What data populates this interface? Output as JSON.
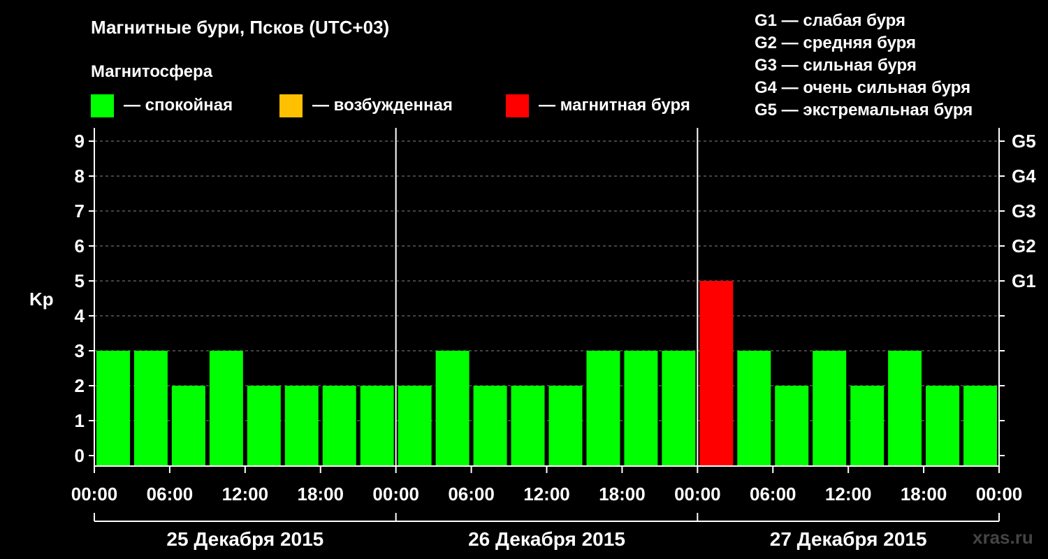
{
  "chart_data": {
    "type": "bar",
    "title": "Магнитные бури, Псков (UTC+03)",
    "subtitle": "Магнитосфера",
    "legend": [
      {
        "label": "— спокойная",
        "color": "#00ff00"
      },
      {
        "label": "— возбужденная",
        "color": "#ffc000"
      },
      {
        "label": "— магнитная буря",
        "color": "#ff0000"
      }
    ],
    "storm_scale_legend": [
      "G1 — слабая буря",
      "G2 — средняя буря",
      "G3 — сильная буря",
      "G4 — очень сильная буря",
      "G5 — экстремальная буря"
    ],
    "ylabel": "Kp",
    "ylim": [
      0,
      9
    ],
    "y_ticks": [
      "0",
      "1",
      "2",
      "3",
      "4",
      "5",
      "6",
      "7",
      "8",
      "9"
    ],
    "right_ticks": [
      {
        "value": 5,
        "label": "G1"
      },
      {
        "value": 6,
        "label": "G2"
      },
      {
        "value": 7,
        "label": "G3"
      },
      {
        "value": 8,
        "label": "G4"
      },
      {
        "value": 9,
        "label": "G5"
      }
    ],
    "x_tick_labels": [
      "00:00",
      "06:00",
      "12:00",
      "18:00",
      "00:00",
      "06:00",
      "12:00",
      "18:00",
      "00:00",
      "06:00",
      "12:00",
      "18:00",
      "00:00"
    ],
    "days": [
      "25 Декабря 2015",
      "26 Декабря 2015",
      "27 Декабря 2015"
    ],
    "interval_hours": 3,
    "values": [
      3,
      3,
      2,
      3,
      2,
      2,
      2,
      2,
      2,
      3,
      2,
      2,
      2,
      3,
      3,
      3,
      5,
      3,
      2,
      3,
      2,
      3,
      2,
      2
    ],
    "grid": true
  },
  "watermark": "xras.ru"
}
